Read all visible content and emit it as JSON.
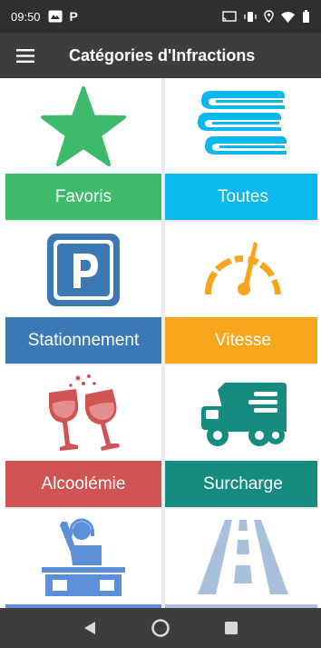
{
  "status_bar": {
    "time": "09:50",
    "app_glyph": "P"
  },
  "app_bar": {
    "title": "Catégories d'Infractions"
  },
  "categories": [
    {
      "label": "Favoris",
      "color": "#3dbb6b",
      "icon": "star-icon"
    },
    {
      "label": "Toutes",
      "color": "#0ab8f0",
      "icon": "books-icon"
    },
    {
      "label": "Stationnement",
      "color": "#3b78b4",
      "icon": "parking-icon"
    },
    {
      "label": "Vitesse",
      "color": "#f7a51c",
      "icon": "speedometer-icon"
    },
    {
      "label": "Alcoolémie",
      "color": "#d15454",
      "icon": "wine-glasses-icon"
    },
    {
      "label": "Surcharge",
      "color": "#168b7f",
      "icon": "truck-icon"
    },
    {
      "label": "",
      "color": "#5b8fd8",
      "icon": "dj-icon"
    },
    {
      "label": "",
      "color": "#a9c0dd",
      "icon": "road-icon"
    }
  ],
  "nav": {
    "back_icon": "back-icon",
    "home_icon": "home-icon",
    "recents_icon": "recents-icon"
  }
}
